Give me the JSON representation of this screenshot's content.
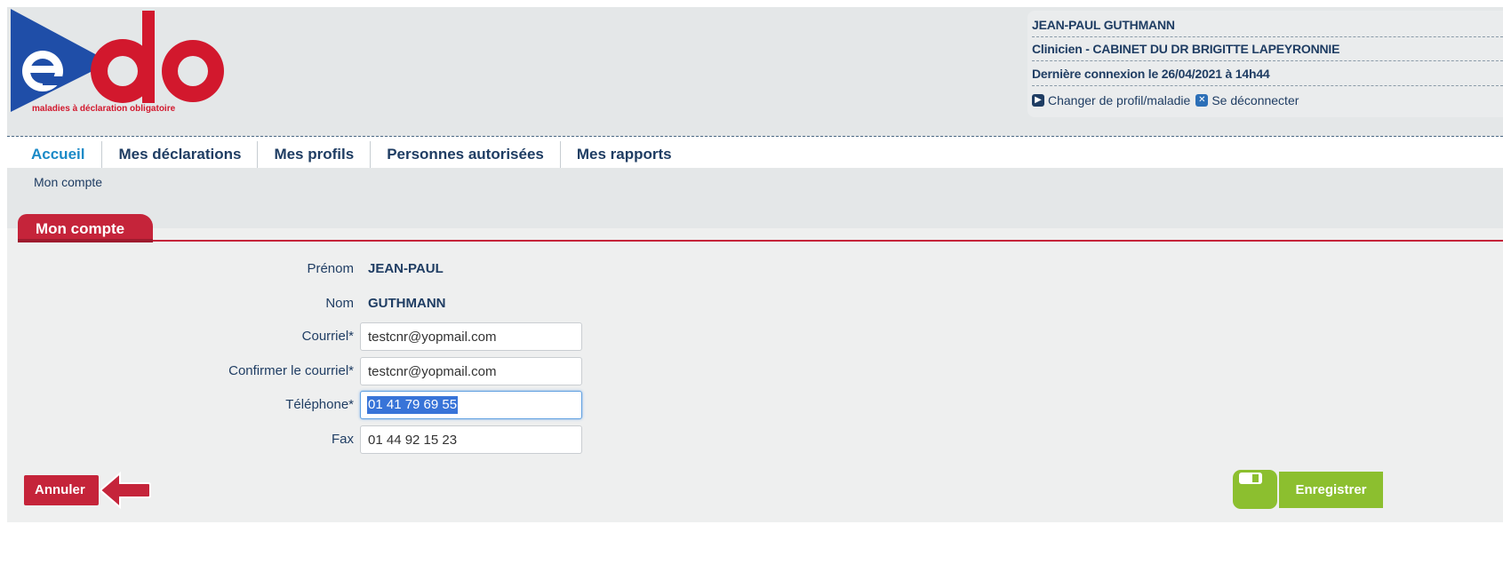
{
  "logo": {
    "letters": "edo",
    "tagline": "maladies à déclaration obligatoire"
  },
  "user": {
    "name": "JEAN-PAUL GUTHMANN",
    "role": "Clinicien - CABINET DU DR BRIGITTE LAPEYRONNIE",
    "last_login": "Dernière connexion le 26/04/2021 à 14h44",
    "change_profile": "Changer de profil/maladie",
    "logout": "Se déconnecter"
  },
  "nav": {
    "items": [
      {
        "label": "Accueil"
      },
      {
        "label": "Mes déclarations"
      },
      {
        "label": "Mes profils"
      },
      {
        "label": "Personnes autorisées"
      },
      {
        "label": "Mes rapports"
      }
    ]
  },
  "breadcrumb": "Mon compte",
  "section": {
    "title": "Mon compte"
  },
  "form": {
    "prenom": {
      "label": "Prénom",
      "value": "JEAN-PAUL"
    },
    "nom": {
      "label": "Nom",
      "value": "GUTHMANN"
    },
    "courriel": {
      "label": "Courriel*",
      "value": "testcnr@yopmail.com"
    },
    "confirm": {
      "label": "Confirmer le courriel*",
      "value": "testcnr@yopmail.com"
    },
    "telephone": {
      "label": "Téléphone*",
      "value": "01 41 79 69 55"
    },
    "fax": {
      "label": "Fax",
      "value": "01 44 92 15 23"
    }
  },
  "buttons": {
    "cancel": "Annuler",
    "save": "Enregistrer"
  },
  "colors": {
    "brand_red": "#d2182d",
    "brand_blue": "#1f3d63",
    "active_nav": "#1b8ac7",
    "save_green": "#8cbf2f"
  },
  "icons": {
    "change_profile": "play-icon",
    "logout": "close-icon",
    "cancel": "back-arrow-icon",
    "save": "save-icon"
  }
}
